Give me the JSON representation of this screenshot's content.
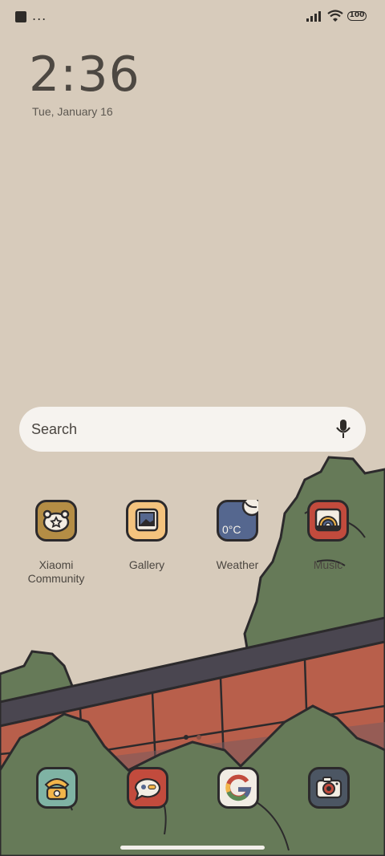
{
  "status_bar": {
    "battery": "100",
    "more": "..."
  },
  "clock": {
    "time": "2:36",
    "date": "Tue, January 16"
  },
  "search": {
    "label": "Search"
  },
  "apps": [
    {
      "label_line1": "Xiaomi",
      "label_line2": "Community",
      "icon": "xiaomi-community-icon"
    },
    {
      "label": "Gallery",
      "icon": "gallery-icon"
    },
    {
      "label": "Weather",
      "icon": "weather-icon",
      "temp": "0°C"
    },
    {
      "label": "Music",
      "icon": "music-icon"
    }
  ],
  "dock": [
    {
      "icon": "phone-icon"
    },
    {
      "icon": "messages-icon"
    },
    {
      "icon": "google-icon"
    },
    {
      "icon": "camera-icon"
    }
  ],
  "page_indicator": {
    "pages": 2,
    "current": 1
  },
  "colors": {
    "background": "#d7cbbb",
    "foliage": "#667a58",
    "brick": "#b85f4b"
  }
}
